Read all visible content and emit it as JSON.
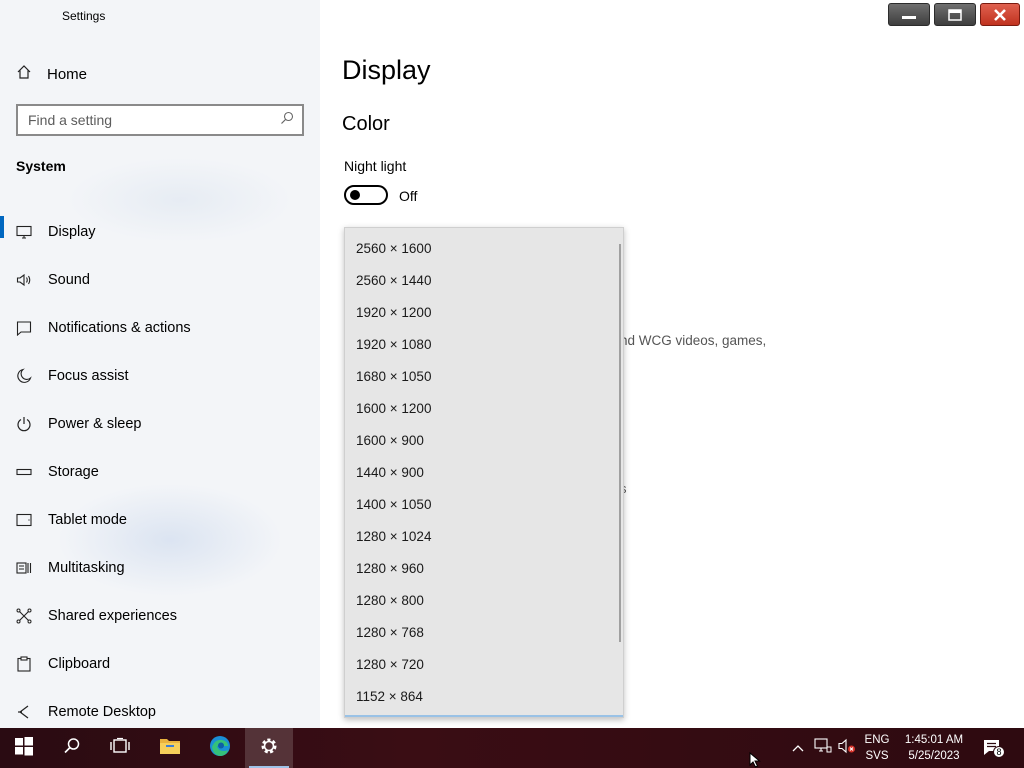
{
  "window": {
    "title": "Settings",
    "controls": {
      "minimize": "minimize",
      "maximize": "maximize",
      "close": "close"
    }
  },
  "sidebar": {
    "home_label": "Home",
    "search_placeholder": "Find a setting",
    "section_title": "System",
    "items": [
      {
        "label": "Display",
        "icon": "monitor-icon",
        "active": true
      },
      {
        "label": "Sound",
        "icon": "speaker-icon"
      },
      {
        "label": "Notifications & actions",
        "icon": "notification-icon"
      },
      {
        "label": "Focus assist",
        "icon": "moon-icon"
      },
      {
        "label": "Power & sleep",
        "icon": "power-icon"
      },
      {
        "label": "Storage",
        "icon": "storage-icon"
      },
      {
        "label": "Tablet mode",
        "icon": "tablet-icon"
      },
      {
        "label": "Multitasking",
        "icon": "multitasking-icon"
      },
      {
        "label": "Shared experiences",
        "icon": "shared-icon"
      },
      {
        "label": "Clipboard",
        "icon": "clipboard-icon"
      },
      {
        "label": "Remote Desktop",
        "icon": "remote-desktop-icon"
      }
    ]
  },
  "main": {
    "page_title": "Display",
    "color_heading": "Color",
    "night_light_label": "Night light",
    "night_light_state": "Off",
    "partial_text": "nd WCG videos, games,",
    "partial_fragment": "s"
  },
  "resolution_dropdown": {
    "options": [
      "2560 × 1600",
      "2560 × 1440",
      "1920 × 1200",
      "1920 × 1080",
      "1680 × 1050",
      "1600 × 1200",
      "1600 × 900",
      "1440 × 900",
      "1400 × 1050",
      "1280 × 1024",
      "1280 × 960",
      "1280 × 800",
      "1280 × 768",
      "1280 × 720",
      "1152 × 864"
    ]
  },
  "taskbar": {
    "apps": [
      "start-icon",
      "search-icon",
      "task-view-icon",
      "file-explorer-icon",
      "edge-icon",
      "settings-icon"
    ],
    "language": "ENG",
    "keyboard": "SVS",
    "time": "1:45:01 AM",
    "date": "5/25/2023",
    "notification_count": "8"
  },
  "colors": {
    "accent": "#0067c0",
    "taskbar": "#2e0a10",
    "dropdown_bg": "#e6e6e6"
  }
}
